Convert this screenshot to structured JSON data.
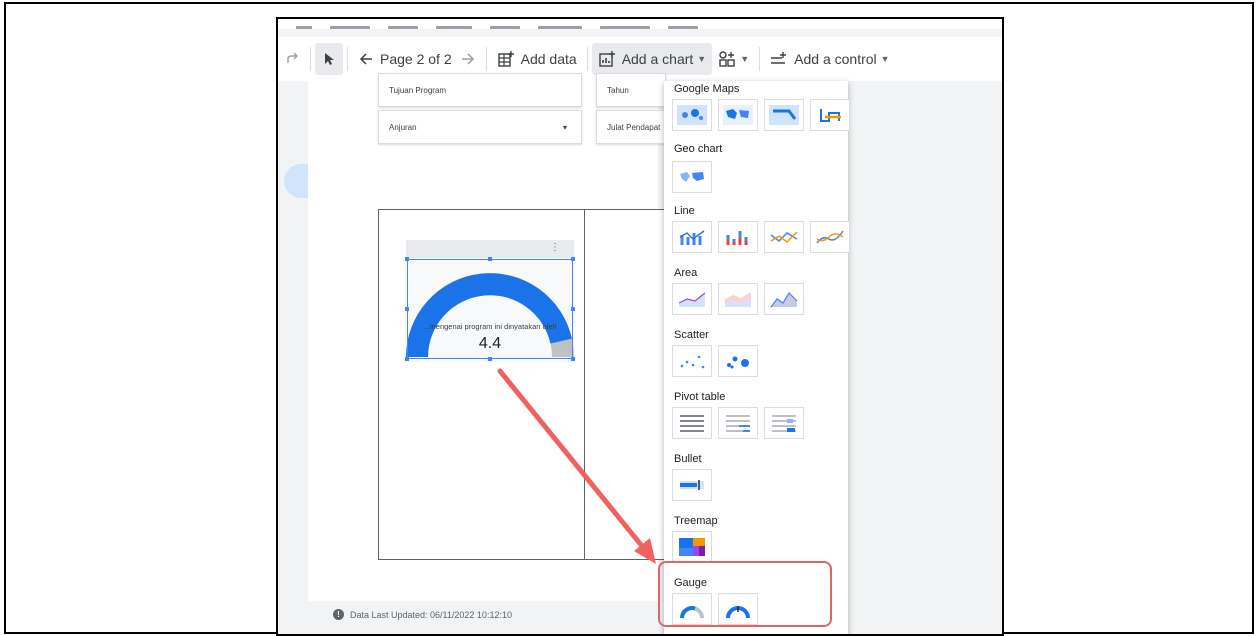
{
  "toolbar": {
    "page_label": "Page 2 of 2",
    "add_data_label": "Add data",
    "add_chart_label": "Add a chart",
    "add_control_label": "Add a control"
  },
  "report": {
    "controls": [
      {
        "label": "Tujuan Program"
      },
      {
        "label": "Tahun"
      },
      {
        "label": "Anjuran"
      },
      {
        "label": "Julat Pendapat"
      }
    ],
    "gauge": {
      "subtitle": "...mengenai program ini dinyatakan oleh",
      "value": "4.4",
      "fill_fraction": 0.93
    },
    "footer_text": "Data Last Updated: 06/11/2022 10:12:10"
  },
  "chart_menu": {
    "sections": [
      {
        "title": "Google Maps"
      },
      {
        "title": "Geo chart"
      },
      {
        "title": "Line"
      },
      {
        "title": "Area"
      },
      {
        "title": "Scatter"
      },
      {
        "title": "Pivot table"
      },
      {
        "title": "Bullet"
      },
      {
        "title": "Treemap"
      },
      {
        "title": "Gauge"
      }
    ]
  },
  "colors": {
    "accent_blue": "#1a73e8",
    "gauge_blue": "#1a73e8",
    "highlight_red": "#e06666"
  }
}
